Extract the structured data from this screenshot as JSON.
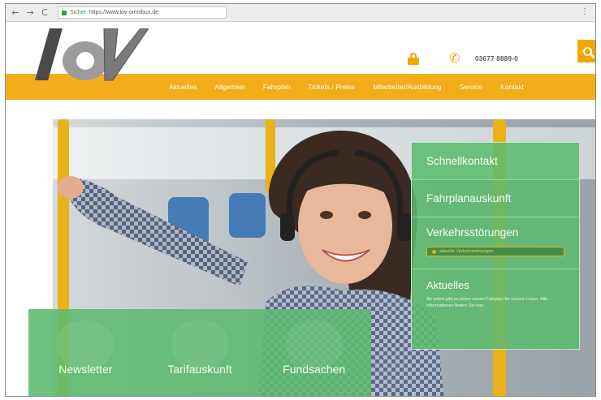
{
  "browser": {
    "back": "←",
    "forward": "→",
    "reload": "C",
    "secure_label": "Sicher",
    "url": "https://www.iov-omnibus.de",
    "menu": "⋮"
  },
  "header": {
    "logo_text": "IOV",
    "phone_number": "03677 8889-0",
    "icons": [
      "lock-icon",
      "phone-icon",
      "search-icon"
    ]
  },
  "nav": {
    "items": [
      "Aktuelles",
      "Allgemein",
      "Fahrplan",
      "Tickets / Preise",
      "Mitarbeiter/Ausbildung",
      "Service",
      "Kontakt"
    ]
  },
  "quick_panel": {
    "items": [
      "Schnellkontakt",
      "Fahrplanauskunft"
    ],
    "disruptions_title": "Verkehrsstörungen",
    "disruption_alert": "aktuelle Verkehrsstörungen",
    "news_title": "Aktuelles",
    "news_text": "Ab sofort gibt es einen neuen Fahrplan für unsere Linien. Alle Informationen finden Sie hier."
  },
  "tiles": [
    "Newsletter",
    "Tarifauskunft",
    "Fundsachen"
  ],
  "colors": {
    "accent": "#f3ad1b",
    "panel_green": "#5cba6e"
  }
}
